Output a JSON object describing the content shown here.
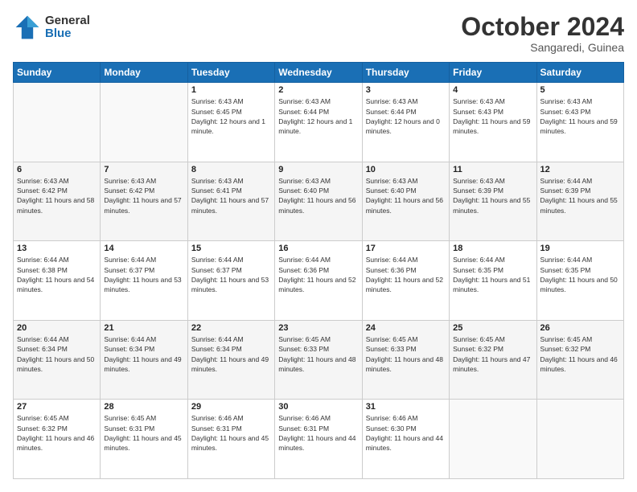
{
  "logo": {
    "line1": "General",
    "line2": "Blue"
  },
  "title": "October 2024",
  "subtitle": "Sangaredi, Guinea",
  "days_of_week": [
    "Sunday",
    "Monday",
    "Tuesday",
    "Wednesday",
    "Thursday",
    "Friday",
    "Saturday"
  ],
  "weeks": [
    [
      {
        "num": "",
        "info": ""
      },
      {
        "num": "",
        "info": ""
      },
      {
        "num": "1",
        "info": "Sunrise: 6:43 AM\nSunset: 6:45 PM\nDaylight: 12 hours and 1 minute."
      },
      {
        "num": "2",
        "info": "Sunrise: 6:43 AM\nSunset: 6:44 PM\nDaylight: 12 hours and 1 minute."
      },
      {
        "num": "3",
        "info": "Sunrise: 6:43 AM\nSunset: 6:44 PM\nDaylight: 12 hours and 0 minutes."
      },
      {
        "num": "4",
        "info": "Sunrise: 6:43 AM\nSunset: 6:43 PM\nDaylight: 11 hours and 59 minutes."
      },
      {
        "num": "5",
        "info": "Sunrise: 6:43 AM\nSunset: 6:43 PM\nDaylight: 11 hours and 59 minutes."
      }
    ],
    [
      {
        "num": "6",
        "info": "Sunrise: 6:43 AM\nSunset: 6:42 PM\nDaylight: 11 hours and 58 minutes."
      },
      {
        "num": "7",
        "info": "Sunrise: 6:43 AM\nSunset: 6:42 PM\nDaylight: 11 hours and 57 minutes."
      },
      {
        "num": "8",
        "info": "Sunrise: 6:43 AM\nSunset: 6:41 PM\nDaylight: 11 hours and 57 minutes."
      },
      {
        "num": "9",
        "info": "Sunrise: 6:43 AM\nSunset: 6:40 PM\nDaylight: 11 hours and 56 minutes."
      },
      {
        "num": "10",
        "info": "Sunrise: 6:43 AM\nSunset: 6:40 PM\nDaylight: 11 hours and 56 minutes."
      },
      {
        "num": "11",
        "info": "Sunrise: 6:43 AM\nSunset: 6:39 PM\nDaylight: 11 hours and 55 minutes."
      },
      {
        "num": "12",
        "info": "Sunrise: 6:44 AM\nSunset: 6:39 PM\nDaylight: 11 hours and 55 minutes."
      }
    ],
    [
      {
        "num": "13",
        "info": "Sunrise: 6:44 AM\nSunset: 6:38 PM\nDaylight: 11 hours and 54 minutes."
      },
      {
        "num": "14",
        "info": "Sunrise: 6:44 AM\nSunset: 6:37 PM\nDaylight: 11 hours and 53 minutes."
      },
      {
        "num": "15",
        "info": "Sunrise: 6:44 AM\nSunset: 6:37 PM\nDaylight: 11 hours and 53 minutes."
      },
      {
        "num": "16",
        "info": "Sunrise: 6:44 AM\nSunset: 6:36 PM\nDaylight: 11 hours and 52 minutes."
      },
      {
        "num": "17",
        "info": "Sunrise: 6:44 AM\nSunset: 6:36 PM\nDaylight: 11 hours and 52 minutes."
      },
      {
        "num": "18",
        "info": "Sunrise: 6:44 AM\nSunset: 6:35 PM\nDaylight: 11 hours and 51 minutes."
      },
      {
        "num": "19",
        "info": "Sunrise: 6:44 AM\nSunset: 6:35 PM\nDaylight: 11 hours and 50 minutes."
      }
    ],
    [
      {
        "num": "20",
        "info": "Sunrise: 6:44 AM\nSunset: 6:34 PM\nDaylight: 11 hours and 50 minutes."
      },
      {
        "num": "21",
        "info": "Sunrise: 6:44 AM\nSunset: 6:34 PM\nDaylight: 11 hours and 49 minutes."
      },
      {
        "num": "22",
        "info": "Sunrise: 6:44 AM\nSunset: 6:34 PM\nDaylight: 11 hours and 49 minutes."
      },
      {
        "num": "23",
        "info": "Sunrise: 6:45 AM\nSunset: 6:33 PM\nDaylight: 11 hours and 48 minutes."
      },
      {
        "num": "24",
        "info": "Sunrise: 6:45 AM\nSunset: 6:33 PM\nDaylight: 11 hours and 48 minutes."
      },
      {
        "num": "25",
        "info": "Sunrise: 6:45 AM\nSunset: 6:32 PM\nDaylight: 11 hours and 47 minutes."
      },
      {
        "num": "26",
        "info": "Sunrise: 6:45 AM\nSunset: 6:32 PM\nDaylight: 11 hours and 46 minutes."
      }
    ],
    [
      {
        "num": "27",
        "info": "Sunrise: 6:45 AM\nSunset: 6:32 PM\nDaylight: 11 hours and 46 minutes."
      },
      {
        "num": "28",
        "info": "Sunrise: 6:45 AM\nSunset: 6:31 PM\nDaylight: 11 hours and 45 minutes."
      },
      {
        "num": "29",
        "info": "Sunrise: 6:46 AM\nSunset: 6:31 PM\nDaylight: 11 hours and 45 minutes."
      },
      {
        "num": "30",
        "info": "Sunrise: 6:46 AM\nSunset: 6:31 PM\nDaylight: 11 hours and 44 minutes."
      },
      {
        "num": "31",
        "info": "Sunrise: 6:46 AM\nSunset: 6:30 PM\nDaylight: 11 hours and 44 minutes."
      },
      {
        "num": "",
        "info": ""
      },
      {
        "num": "",
        "info": ""
      }
    ]
  ]
}
